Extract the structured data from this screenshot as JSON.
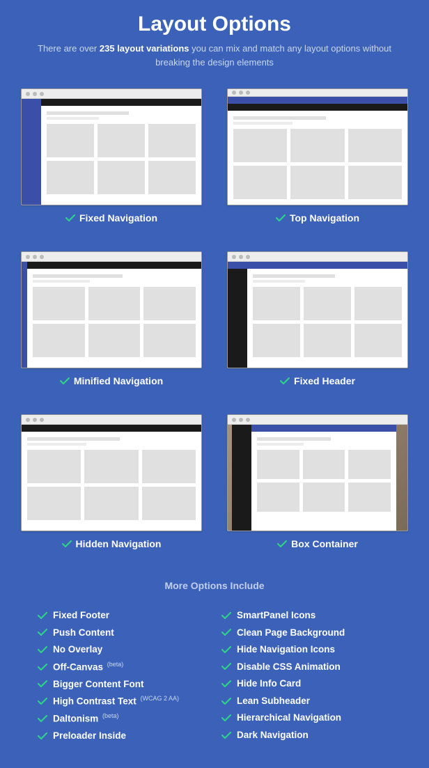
{
  "title": "Layout Options",
  "subtitle_pre": "There are over ",
  "subtitle_bold": "235 layout variations",
  "subtitle_post": " you can mix and match any layout options without breaking the design elements",
  "layouts": [
    {
      "label": "Fixed Navigation"
    },
    {
      "label": "Top Navigation"
    },
    {
      "label": "Minified Navigation"
    },
    {
      "label": "Fixed Header"
    },
    {
      "label": "Hidden Navigation"
    },
    {
      "label": "Box Container"
    }
  ],
  "more_title": "More Options Include",
  "col1": [
    {
      "text": "Fixed Footer",
      "sup": ""
    },
    {
      "text": "Push Content",
      "sup": ""
    },
    {
      "text": "No Overlay",
      "sup": ""
    },
    {
      "text": "Off-Canvas",
      "sup": "(beta)"
    },
    {
      "text": "Bigger Content Font",
      "sup": ""
    },
    {
      "text": "High Contrast Text",
      "sup": "(WCAG 2 AA)"
    },
    {
      "text": "Daltonism",
      "sup": "(beta)"
    },
    {
      "text": "Preloader Inside",
      "sup": ""
    }
  ],
  "col2": [
    {
      "text": "SmartPanel Icons",
      "sup": ""
    },
    {
      "text": "Clean Page Background",
      "sup": ""
    },
    {
      "text": "Hide Navigation Icons",
      "sup": ""
    },
    {
      "text": "Disable CSS Animation",
      "sup": ""
    },
    {
      "text": "Hide Info Card",
      "sup": ""
    },
    {
      "text": "Lean Subheader",
      "sup": ""
    },
    {
      "text": "Hierarchical Navigation",
      "sup": ""
    },
    {
      "text": "Dark Navigation",
      "sup": ""
    }
  ],
  "colors": {
    "check": "#2fd18a"
  }
}
